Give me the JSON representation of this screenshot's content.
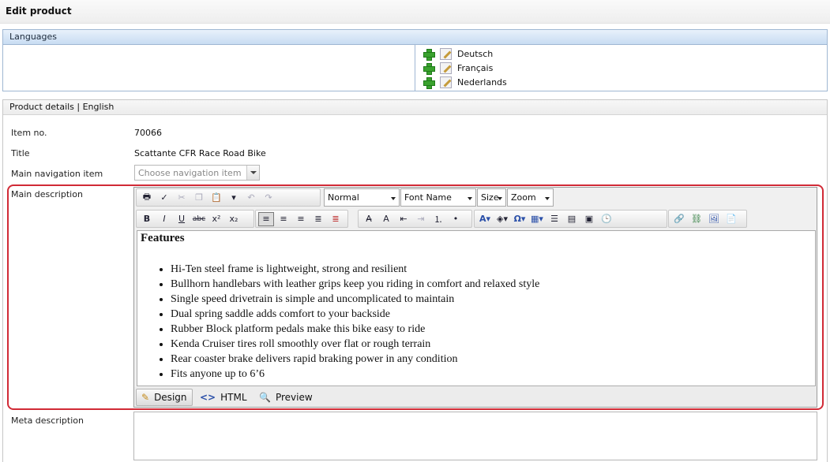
{
  "page": {
    "title": "Edit product"
  },
  "languages": {
    "header": "Languages",
    "items": [
      {
        "label": "Deutsch",
        "add_icon": "plus-icon",
        "edit_icon": "edit-page-icon"
      },
      {
        "label": "Français",
        "add_icon": "plus-icon",
        "edit_icon": "edit-page-icon"
      },
      {
        "label": "Nederlands",
        "add_icon": "plus-icon",
        "edit_icon": "edit-page-icon"
      }
    ]
  },
  "details": {
    "header": "Product details | English",
    "item_no_label": "Item no.",
    "item_no": "70066",
    "title_label": "Title",
    "title": "Scattante CFR Race Road Bike",
    "nav_label": "Main navigation item",
    "nav_placeholder": "Choose navigation item",
    "main_desc_label": "Main description",
    "meta_desc_label": "Meta description"
  },
  "editor": {
    "format_select": "Normal",
    "font_select": "Font Name",
    "size_select": "Size",
    "zoom_select": "Zoom",
    "content_heading": "Features",
    "bullets": [
      "Hi-Ten steel frame is lightweight, strong and resilient",
      "Bullhorn handlebars with leather grips keep you riding in comfort and relaxed style",
      "Single speed drivetrain is simple and uncomplicated to maintain",
      "Dual spring saddle adds comfort to your backside",
      "Rubber Block platform pedals make this bike easy to ride",
      "Kenda Cruiser tires roll smoothly over flat or rough terrain",
      "Rear coaster brake delivers rapid braking power in any condition",
      "Fits anyone up to 6’6"
    ],
    "modes": {
      "design": "Design",
      "html": "HTML",
      "preview": "Preview"
    }
  },
  "colors": {
    "highlight": "#d12a36",
    "panel_border": "#9fb7d3",
    "panel_head": "#c8dcf2"
  }
}
